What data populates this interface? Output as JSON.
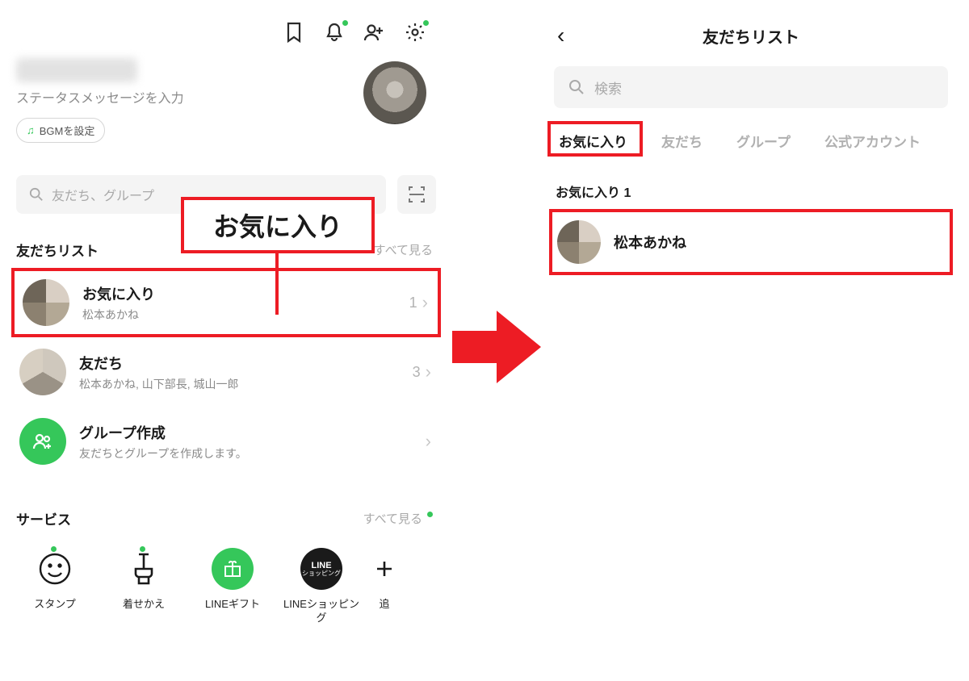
{
  "left": {
    "status_msg_placeholder": "ステータスメッセージを入力",
    "bgm_label": "BGMを設定",
    "search_placeholder": "友だち、グループ",
    "callout_label": "お気に入り",
    "friends_list_title": "友だちリスト",
    "see_all": "すべて見る",
    "rows": {
      "favorites": {
        "title": "お気に入り",
        "sub": "松本あかね",
        "count": "1"
      },
      "friends": {
        "title": "友だち",
        "sub": "松本あかね, 山下部長, 城山一郎",
        "count": "3"
      },
      "group": {
        "title": "グループ作成",
        "sub": "友だちとグループを作成します。"
      }
    },
    "services_title": "サービス",
    "services": [
      {
        "label": "スタンプ"
      },
      {
        "label": "着せかえ"
      },
      {
        "label": "LINEギフト"
      },
      {
        "label": "LINEショッピング",
        "chip1": "LINE",
        "chip2": "ショッピング"
      },
      {
        "label": "追"
      }
    ]
  },
  "right": {
    "title": "友だちリスト",
    "search_placeholder": "検索",
    "tabs": {
      "favorites": "お気に入り",
      "friends": "友だち",
      "groups": "グループ",
      "official": "公式アカウント"
    },
    "section_label": "お気に入り 1",
    "favorite_name": "松本あかね"
  }
}
